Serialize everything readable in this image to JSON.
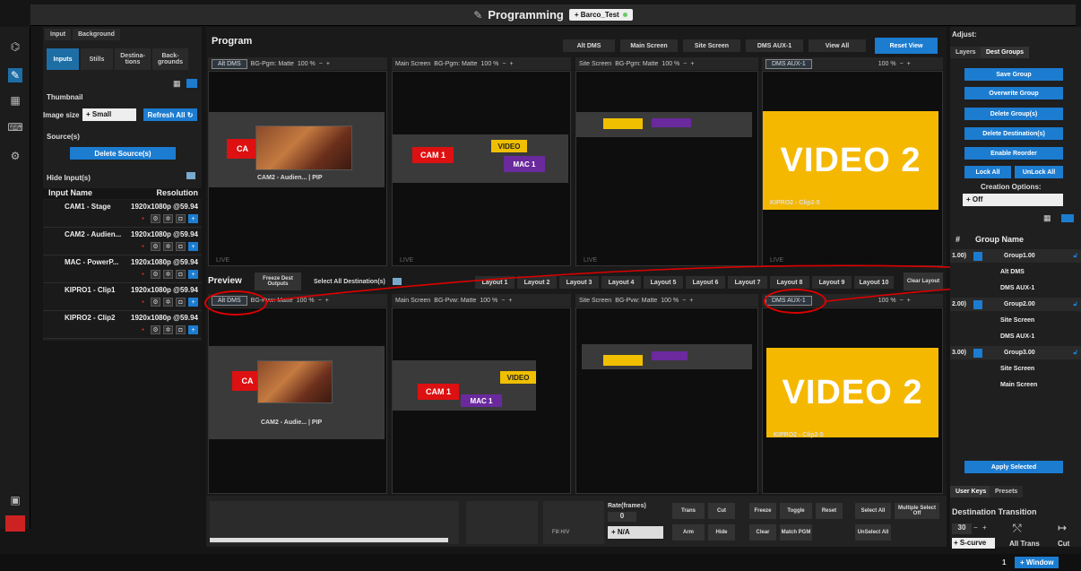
{
  "title_bar": {
    "title": "Programming",
    "preset_label": "+ Barco_Test"
  },
  "left_panel": {
    "top_tabs": [
      "Input",
      "Background"
    ],
    "sub_tabs": [
      "Inputs",
      "Stills",
      "Destina-tions",
      "Back-grounds"
    ],
    "thumbnail_label": "Thumbnail",
    "image_size_label": "Image size",
    "image_size_value": "+ Small",
    "refresh_all": "Refresh All",
    "sources_label": "Source(s)",
    "delete_sources": "Delete Source(s)",
    "hide_inputs": "Hide Input(s)",
    "col_name": "Input Name",
    "col_res": "Resolution",
    "inputs": [
      {
        "name": "CAM1 - Stage",
        "res": "1920x1080p @59.94"
      },
      {
        "name": "CAM2 - Audien...",
        "res": "1920x1080p @59.94"
      },
      {
        "name": "MAC - PowerP...",
        "res": "1920x1080p @59.94"
      },
      {
        "name": "KIPRO1 - Clip1",
        "res": "1920x1080p @59.94"
      },
      {
        "name": "KIPRO2 - Clip2",
        "res": "1920x1080p @59.94"
      }
    ]
  },
  "program": {
    "title": "Program",
    "header_buttons": [
      "Alt DMS",
      "Main Screen",
      "Site Screen",
      "DMS AUX-1",
      "View All"
    ],
    "reset_view": "Reset View",
    "screens": [
      {
        "name": "Alt DMS",
        "bg": "BG-Pgm: Matte",
        "zoom": "100 %"
      },
      {
        "name": "Main Screen",
        "bg": "BG-Pgm: Matte",
        "zoom": "100 %"
      },
      {
        "name": "Site Screen",
        "bg": "BG-Pgm: Matte",
        "zoom": "100 %"
      },
      {
        "name": "DMS AUX-1",
        "bg": "",
        "zoom": "100 %"
      }
    ],
    "caption_pip": "CAM2 - Audien... | PIP",
    "caption_kipro": "KIPRO2 - Clip2-5",
    "live": "LIVE",
    "video2": "VIDEO 2",
    "cam1": "CAM 1",
    "mac1": "MAC 1",
    "video": "VIDEO"
  },
  "preview": {
    "title": "Preview",
    "freeze": "Freeze Dest Outputs",
    "select_all": "Select All Destination(s)",
    "layouts": [
      "Layout 1",
      "Layout 2",
      "Layout 3",
      "Layout 4",
      "Layout 5",
      "Layout 6",
      "Layout 7",
      "Layout 8",
      "Layout 9",
      "Layout 10"
    ],
    "clear_layout": "Clear Layout",
    "screens": [
      {
        "name": "Alt DMS",
        "bg": "BG-Pvw: Matte",
        "zoom": "100 %"
      },
      {
        "name": "Main Screen",
        "bg": "BG-Pvw: Matte",
        "zoom": "100 %"
      },
      {
        "name": "Site Screen",
        "bg": "BG-Pvw: Matte",
        "zoom": "100 %"
      },
      {
        "name": "DMS AUX-1",
        "bg": "",
        "zoom": "100 %"
      }
    ],
    "caption_pip": "CAM2 - Audie... | PIP",
    "caption_kipro": "KIPRO2 - Clip2-5",
    "video2": "VIDEO 2",
    "cam1": "CAM 1",
    "mac1": "MAC 1",
    "video": "VIDEO"
  },
  "bottom": {
    "rate_label": "Rate(frames)",
    "rate_value": "0",
    "na": "+ N/A",
    "fill": "Fill H/V",
    "trans": "Trans",
    "cut": "Cut",
    "arm": "Arm",
    "hide": "Hide",
    "freeze": "Freeze",
    "toggle": "Toggle",
    "reset": "Reset",
    "clear": "Clear",
    "match_pgm": "Match PGM",
    "select_all": "Select All",
    "multiple_select_off": "Multiple Select Off",
    "unselect_all": "UnSelect All"
  },
  "right_panel": {
    "adjust": "Adjust:",
    "tabs": [
      "Layers",
      "Dest Groups"
    ],
    "buttons": [
      "Save Group",
      "Overwrite Group",
      "Delete Group(s)",
      "Delete Destination(s)",
      "Enable Reorder"
    ],
    "lock_all": "Lock All",
    "unlock_all": "UnLock All",
    "creation_options": "Creation Options:",
    "creation_value": "+ Off",
    "col_num": "#",
    "col_name": "Group Name",
    "groups": [
      {
        "num": "1.00)",
        "name": "Group1.00",
        "members": [
          "Alt DMS",
          "DMS AUX-1"
        ]
      },
      {
        "num": "2.00)",
        "name": "Group2.00",
        "members": [
          "Site Screen",
          "DMS AUX-1"
        ]
      },
      {
        "num": "3.00)",
        "name": "Group3.00",
        "members": [
          "Site Screen",
          "Main Screen"
        ]
      }
    ],
    "apply_selected": "Apply Selected",
    "bottom_tabs": [
      "User Keys",
      "Presets"
    ],
    "dest_transition": "Destination Transition",
    "dt_value": "30",
    "s_curve": "+ S-curve",
    "all_trans": "All Trans",
    "cut": "Cut"
  },
  "status_bar": {
    "page": "1",
    "window": "+ Window"
  },
  "colors": {
    "accent": "#1c7cd0",
    "video2": "#f5b800",
    "annotation": "#dd0000"
  }
}
